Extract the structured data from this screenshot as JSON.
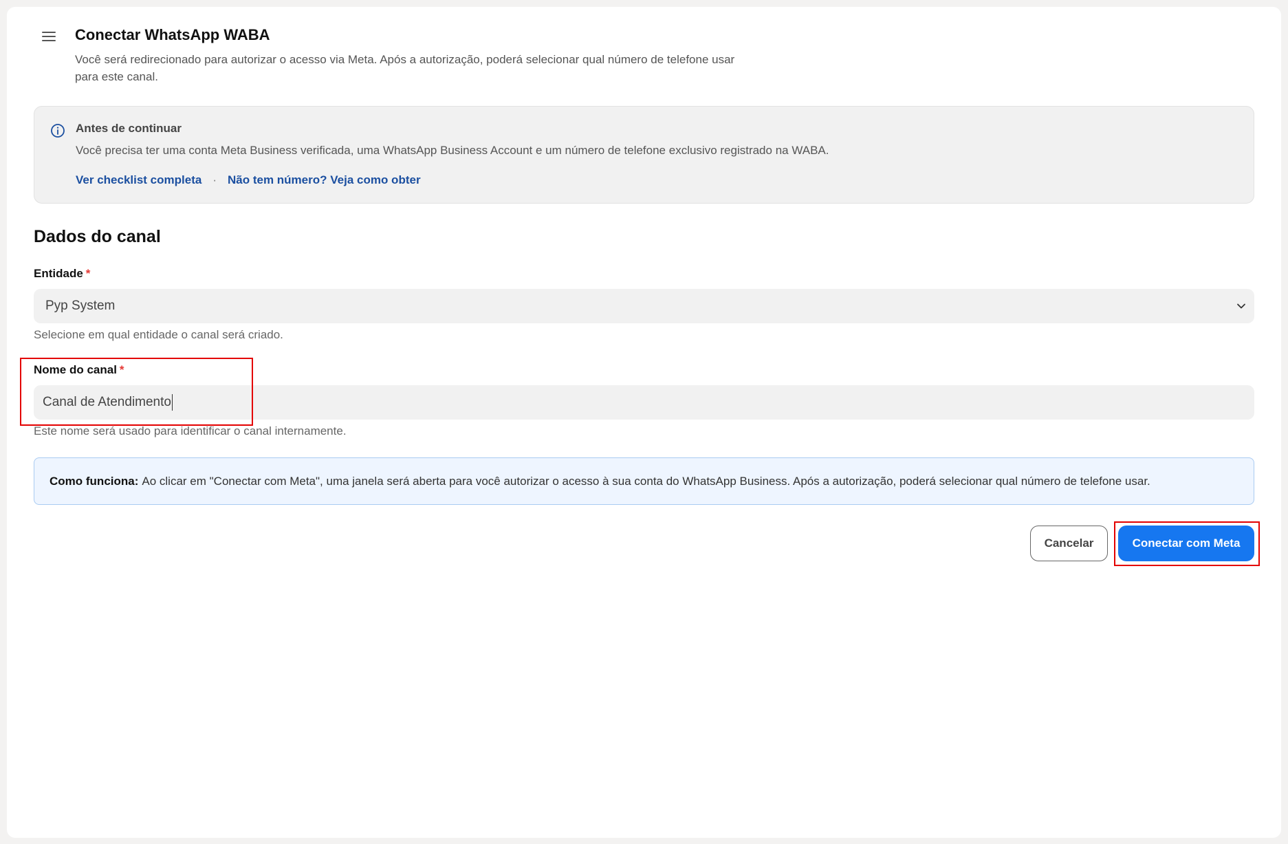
{
  "header": {
    "title": "Conectar WhatsApp WABA",
    "subtitle": "Você será redirecionado para autorizar o acesso via Meta. Após a autorização, poderá selecionar qual número de telefone usar para este canal."
  },
  "notice": {
    "title": "Antes de continuar",
    "text": "Você precisa ter uma conta Meta Business verificada, uma WhatsApp Business Account e um número de telefone exclusivo registrado na WABA.",
    "link_checklist": "Ver checklist completa",
    "separator": "·",
    "link_number": "Não tem número? Veja como obter"
  },
  "form": {
    "section_title": "Dados do canal",
    "entity": {
      "label": "Entidade",
      "required_mark": "*",
      "selected": "Pyp System",
      "help": "Selecione em qual entidade o canal será criado."
    },
    "channel_name": {
      "label": "Nome do canal",
      "required_mark": "*",
      "value": "Canal de Atendimento",
      "help": "Este nome será usado para identificar o canal internamente."
    }
  },
  "how_it_works": {
    "label": "Como funciona:",
    "text": "Ao clicar em \"Conectar com Meta\", uma janela será aberta para você autorizar o acesso à sua conta do WhatsApp Business. Após a autorização, poderá selecionar qual número de telefone usar."
  },
  "actions": {
    "cancel": "Cancelar",
    "connect": "Conectar com Meta"
  },
  "colors": {
    "primary": "#1677f0",
    "link": "#1b4fa0",
    "required": "#e53935",
    "highlight": "#e30000",
    "info_bg": "#eef5ff"
  },
  "icons": [
    "menu-icon",
    "info-icon",
    "chevron-down-icon"
  ]
}
